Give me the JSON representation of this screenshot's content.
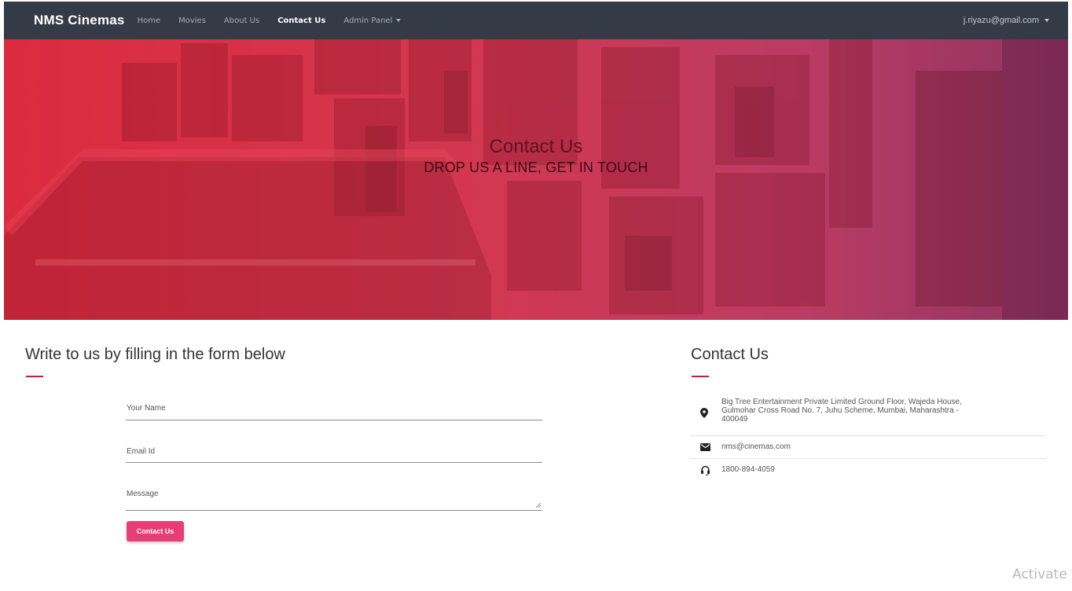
{
  "navbar": {
    "brand": "NMS Cinemas",
    "items": [
      {
        "label": "Home"
      },
      {
        "label": "Movies"
      },
      {
        "label": "About Us"
      },
      {
        "label": "Contact Us",
        "active": true
      },
      {
        "label": "Admin Panel",
        "dropdown": true
      }
    ],
    "user": "j.riyazu@gmail.com"
  },
  "hero": {
    "title": "Contact Us",
    "subtitle": "DROP US A LINE, GET IN TOUCH"
  },
  "form": {
    "heading": "Write to us by filling in the form below",
    "name_placeholder": "Your Name",
    "email_placeholder": "Email Id",
    "message_placeholder": "Message",
    "submit_label": "Contact Us"
  },
  "contact": {
    "heading": "Contact Us",
    "address_line1": "Big Tree Entertainment Private Limited Ground Floor, Wajeda House,",
    "address_line2": "Gulmohar Cross Road No. 7, Juhu Scheme, Mumbai, Maharashtra -",
    "address_line3": "400049",
    "email": "nms@cinemas.com",
    "phone": "1800-894-4059"
  },
  "watermark": "Activate",
  "colors": {
    "navbar": "#343a46",
    "accent": "#e83e78",
    "rule": "#c0203a",
    "hero_red": "#e01e34",
    "hero_purple": "#7c2a60"
  },
  "icons": [
    "caret-down-icon",
    "location-pin-icon",
    "envelope-icon",
    "headset-icon",
    "resize-grip-icon"
  ]
}
